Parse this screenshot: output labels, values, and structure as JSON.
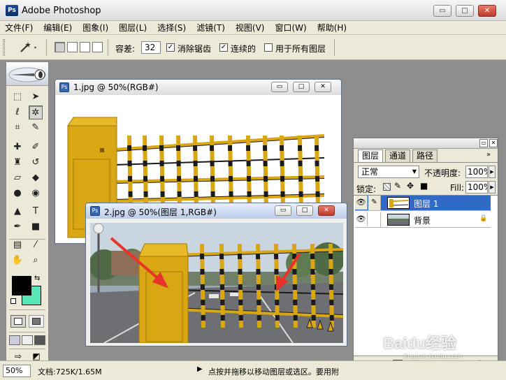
{
  "app": {
    "title": "Adobe Photoshop",
    "logo_text": "Ps",
    "window_buttons": {
      "min": "▭",
      "max": "□",
      "close": "✕"
    }
  },
  "menu": [
    "文件(F)",
    "编辑(E)",
    "图象(I)",
    "图层(L)",
    "选择(S)",
    "滤镜(T)",
    "视图(V)",
    "窗口(W)",
    "帮助(H)"
  ],
  "options": {
    "tool_icon": "magic-wand-icon",
    "tolerance_label": "容差:",
    "tolerance_value": "32",
    "anti_alias": {
      "label": "消除锯齿",
      "checked": true
    },
    "contiguous": {
      "label": "连续的",
      "checked": true
    },
    "all_layers": {
      "label": "用于所有图层",
      "checked": false
    }
  },
  "toolbox": {
    "tools": [
      [
        "marquee-icon",
        "move-icon"
      ],
      [
        "lasso-icon",
        "magic-wand-icon"
      ],
      [
        "crop-icon",
        "slice-icon"
      ],
      [
        "healing-brush-icon",
        "brush-icon"
      ],
      [
        "clone-stamp-icon",
        "history-brush-icon"
      ],
      [
        "eraser-icon",
        "paint-bucket-icon"
      ],
      [
        "blur-icon",
        "dodge-icon"
      ],
      [
        "path-select-icon",
        "type-icon"
      ],
      [
        "pen-icon",
        "rectangle-icon"
      ],
      [
        "notes-icon",
        "eyedropper-icon"
      ],
      [
        "hand-icon",
        "zoom-icon"
      ]
    ],
    "foreground_color": "#000000",
    "background_color": "#58e6b6"
  },
  "documents": [
    {
      "title": "1.jpg @ 50%(RGB#)"
    },
    {
      "title": "2.jpg @ 50%(图层 1,RGB#)"
    }
  ],
  "layers_panel": {
    "tabs": [
      "图层",
      "通道",
      "路径"
    ],
    "blend_mode": "正常",
    "opacity_label": "不透明度:",
    "opacity_value": "100%",
    "lock_label": "锁定:",
    "fill_label": "Fill:",
    "fill_value": "100%",
    "layers": [
      {
        "name": "图层 1",
        "selected": true
      },
      {
        "name": "背景",
        "selected": false,
        "locked": true
      }
    ]
  },
  "status": {
    "zoom": "50%",
    "doc_info": "文档:725K/1.65M",
    "hint": "点按并拖移以移动图层或选区。要用附"
  },
  "watermark": {
    "text": "Baidu经验",
    "sub": "jingyan.baidu.com"
  },
  "colors": {
    "accent": "#3169c6",
    "gate_yellow": "#d9a614",
    "arrow": "#e8332a"
  }
}
